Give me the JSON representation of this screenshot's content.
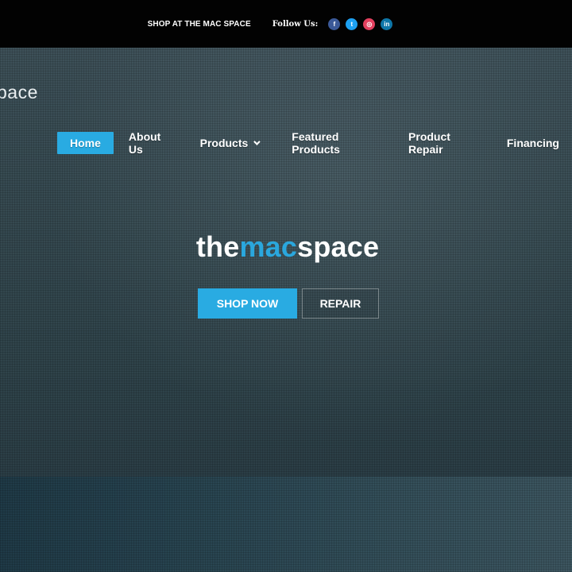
{
  "topbar": {
    "shop_link": "SHOP AT THE MAC SPACE",
    "follow_label": "Follow Us:",
    "social": [
      {
        "icon": "facebook-icon",
        "glyph": "f",
        "color": "#3b5998"
      },
      {
        "icon": "twitter-icon",
        "glyph": "t",
        "color": "#1da1f2"
      },
      {
        "icon": "instagram-icon",
        "glyph": "◎",
        "color": "#e4405f"
      },
      {
        "icon": "linkedin-icon",
        "glyph": "in",
        "color": "#0e76a8"
      }
    ]
  },
  "logo": {
    "partial_text": "pace"
  },
  "nav": {
    "items": [
      {
        "label": "Home",
        "active": true
      },
      {
        "label": "About Us"
      },
      {
        "label": "Products",
        "has_dropdown": true
      },
      {
        "label": "Featured Products"
      },
      {
        "label": "Product Repair"
      },
      {
        "label": "Financing"
      }
    ]
  },
  "hero": {
    "brand_part1": "the",
    "brand_part2": "mac",
    "brand_part3": "space",
    "shop_button": "SHOP NOW",
    "repair_button": "REPAIR"
  },
  "colors": {
    "accent": "#29abe2",
    "topbar": "#020202"
  }
}
